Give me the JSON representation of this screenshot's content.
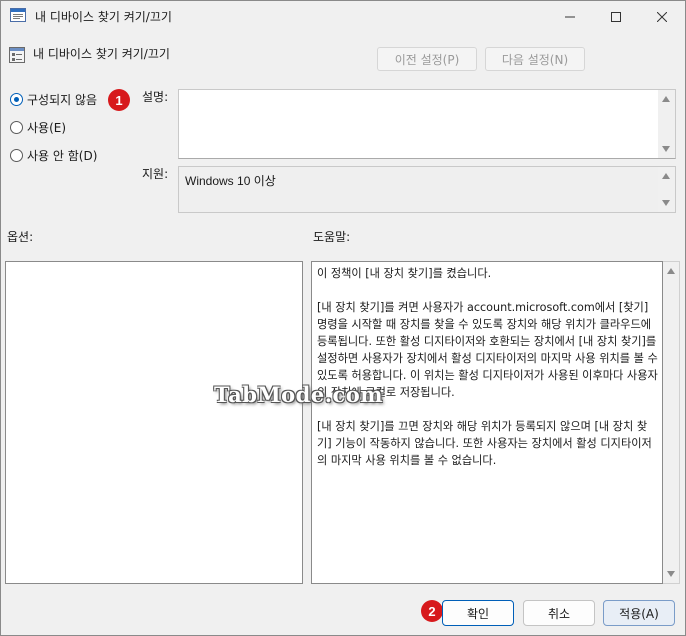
{
  "window": {
    "title": "내 디바이스 찾기 켜기/끄기",
    "controls": {
      "minimize_icon": "minimize-icon",
      "maximize_icon": "maximize-icon",
      "close_icon": "close-icon"
    }
  },
  "header": {
    "title": "내 디바이스 찾기 켜기/끄기",
    "prev_label": "이전 설정(P)",
    "next_label": "다음 설정(N)"
  },
  "radios": [
    {
      "label": "구성되지 않음",
      "checked": true
    },
    {
      "label": "사용(E)",
      "checked": false
    },
    {
      "label": "사용 안 함(D)",
      "checked": false
    }
  ],
  "labels": {
    "description": "설명:",
    "supported_on": "지원:",
    "options": "옵션:",
    "help": "도움말:"
  },
  "supported_on_value": "Windows 10 이상",
  "help_paragraphs": [
    "이 정책이 [내 장치 찾기]를 켰습니다.",
    "[내 장치 찾기]를 켜면 사용자가 account.microsoft.com에서 [찾기] 명령을 시작할 때 장치를 찾을 수 있도록 장치와 해당 위치가 클라우드에 등록됩니다. 또한 활성 디지타이저와 호환되는 장치에서 [내 장치 찾기]를 설정하면 사용자가 장치에서 활성 디지타이저의 마지막 사용 위치를 볼 수 있도록 허용합니다. 이 위치는 활성 디지타이저가 사용된 이후마다 사용자의 장치에 로컬로 저장됩니다.",
    "[내 장치 찾기]를 끄면 장치와 해당 위치가 등록되지 않으며 [내 장치 찾기] 기능이 작동하지 않습니다. 또한 사용자는 장치에서 활성 디지타이저의 마지막 사용 위치를 볼 수 없습니다."
  ],
  "watermark": "TabMode.com",
  "badges": [
    "1",
    "2"
  ],
  "footer": {
    "ok_label": "확인",
    "cancel_label": "취소",
    "apply_label": "적용(A)"
  },
  "colors": {
    "accent": "#005fb8",
    "badge": "#d7191c"
  }
}
